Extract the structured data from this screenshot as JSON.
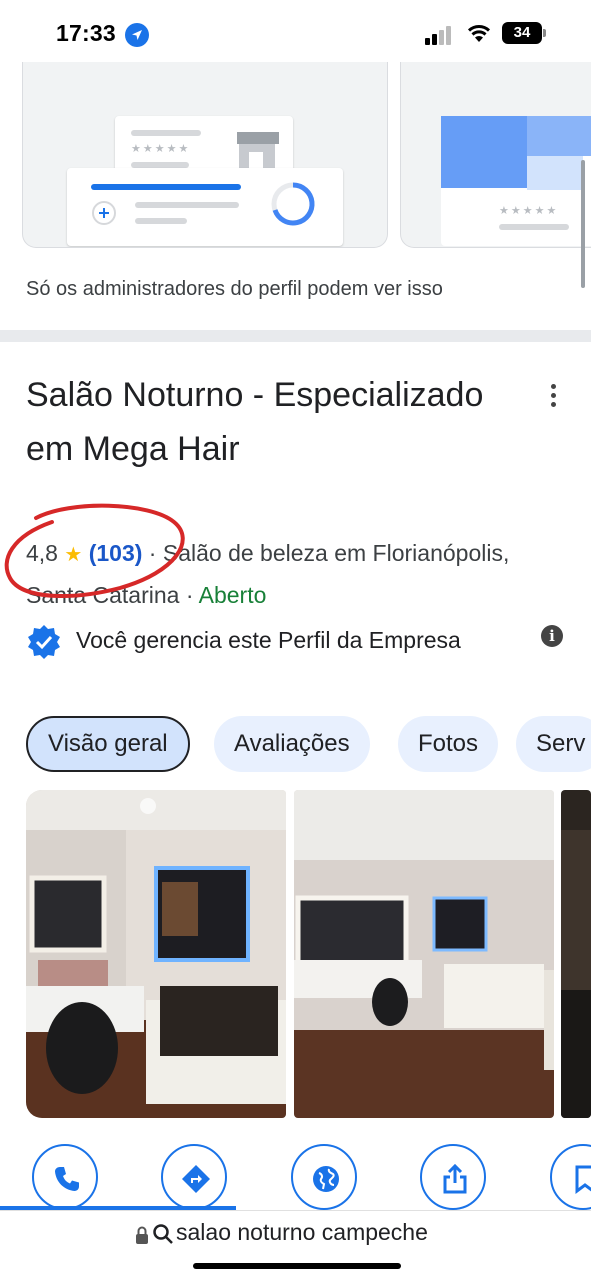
{
  "status_bar": {
    "time": "17:33",
    "battery": "34",
    "icons": [
      "location-arrow-icon",
      "signal-icon",
      "wifi-icon",
      "battery-icon"
    ]
  },
  "admin_section": {
    "note": "Só os administradores do perfil podem ver isso"
  },
  "business": {
    "name": "Salão Noturno - Especializado em Mega Hair",
    "rating": "4,8",
    "star": "★",
    "review_count": "(103)",
    "category_sep": " · ",
    "category": "Salão de beleza em Florianópolis, Santa Catarina",
    "status_sep": " · ",
    "status": "Aberto",
    "verified_text": "Você gerencia este Perfil da Empresa",
    "info_icon": "i"
  },
  "tabs": [
    {
      "label": "Visão geral",
      "active": true
    },
    {
      "label": "Avaliações",
      "active": false
    },
    {
      "label": "Fotos",
      "active": false
    },
    {
      "label": "Serv",
      "active": false
    }
  ],
  "actions": [
    "phone-icon",
    "directions-icon",
    "website-icon",
    "share-icon",
    "save-icon"
  ],
  "address_bar": {
    "text": "salao noturno campeche"
  },
  "colors": {
    "accent": "#1a73e8",
    "open": "#188038",
    "star": "#fbbc04",
    "chip": "#e8f0fe",
    "annotation": "#d62828"
  }
}
